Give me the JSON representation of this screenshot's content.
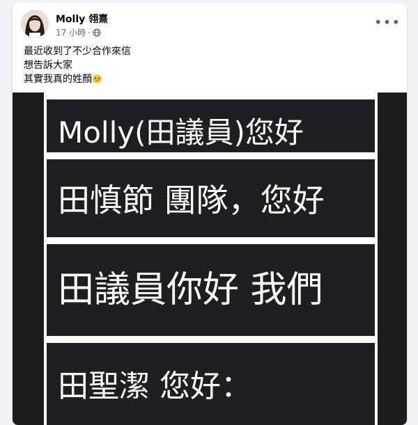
{
  "post": {
    "author": "Molly 翎熹",
    "time": "17 小時",
    "dot": "·",
    "more": "•••",
    "lines": [
      "最近收到了不少合作來信",
      "想告訴大家",
      "其實我真的姓顏"
    ],
    "emoji": "smiling-face-with-tear"
  },
  "image": {
    "strips": [
      "Molly(田議員)您好",
      "田慎節 團隊，您好",
      "田議員你好 我們",
      "田聖潔 您好："
    ]
  },
  "colors": {
    "page_bg": "#f0f2f5",
    "card_bg": "#ffffff",
    "text": "#050505",
    "meta": "#65676b",
    "strip_bg": "#1e1f22"
  }
}
